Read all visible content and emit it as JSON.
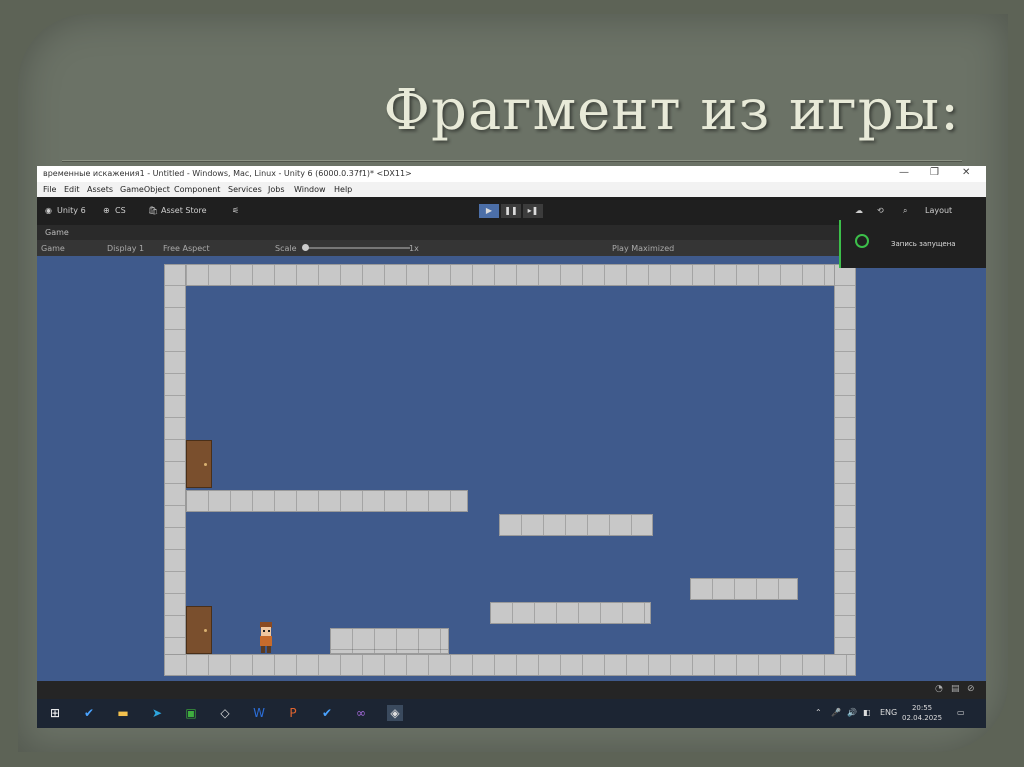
{
  "slide": {
    "title": "Фрагмент из игры:"
  },
  "window": {
    "title": "временные искажения1 - Untitled - Windows, Mac, Linux - Unity 6 (6000.0.37f1)* <DX11>",
    "minimize": "—",
    "restore": "❐",
    "close": "✕"
  },
  "menu": [
    "File",
    "Edit",
    "Assets",
    "GameObject",
    "Component",
    "Services",
    "Jobs",
    "Window",
    "Help"
  ],
  "toolbar": {
    "account": "Unity 6",
    "cloud": "CS",
    "asset_store": "Asset Store",
    "layout": "Layout",
    "play": "▶",
    "pause": "❚❚",
    "step": "▸❚"
  },
  "game_tab": {
    "label": "Game"
  },
  "game_bar": {
    "view": "Game",
    "display": "Display 1",
    "aspect": "Free Aspect",
    "scale_label": "Scale",
    "scale_value": "1x",
    "play_mode": "Play Maximized"
  },
  "toast": {
    "text": "Запись запущена"
  },
  "taskbar": {
    "lang": "ENG",
    "time": "20:55",
    "date": "02.04.2025"
  },
  "colors": {
    "sky": "#3f5a8c",
    "wall": "#c8c8c8",
    "door": "#7a4f2d",
    "accent_green": "#3cbf4a"
  }
}
